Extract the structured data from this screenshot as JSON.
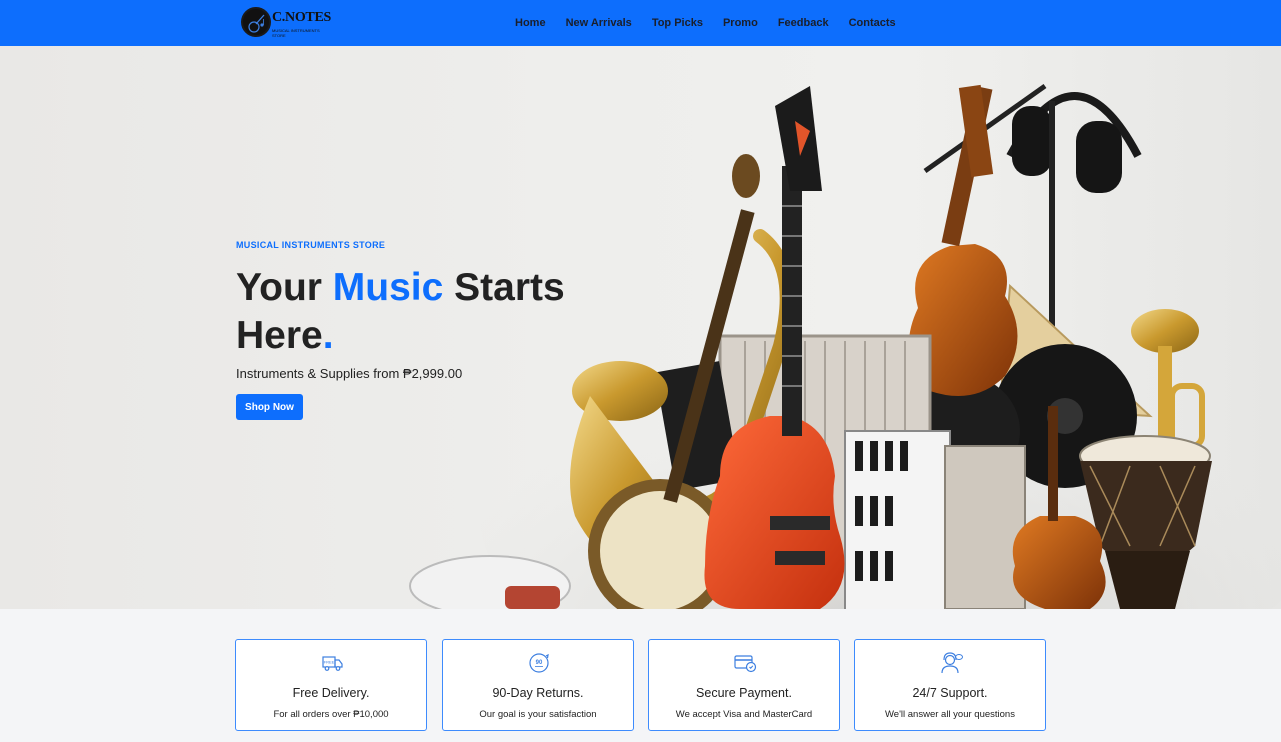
{
  "brand": {
    "name": "C.NOTES",
    "tagline": "MUSICAL INSTRUMENTS STORE"
  },
  "nav": {
    "items": [
      "Home",
      "New Arrivals",
      "Top Picks",
      "Promo",
      "Feedback",
      "Contacts"
    ]
  },
  "hero": {
    "eyebrow": "MUSICAL INSTRUMENTS STORE",
    "headline_part1": "Your ",
    "headline_accent": "Music",
    "headline_part2": " Starts Here",
    "headline_dot": ".",
    "subtitle": "Instruments & Supplies from ₱2,999.00",
    "cta_label": "Shop Now"
  },
  "features": [
    {
      "icon": "free-delivery-truck-icon",
      "title": "Free Delivery.",
      "description": "For all orders over ₱10,000"
    },
    {
      "icon": "90-day-returns-icon",
      "title": "90-Day Returns.",
      "description": "Our goal is your satisfaction"
    },
    {
      "icon": "secure-payment-card-icon",
      "title": "Secure Payment.",
      "description": "We accept Visa and MasterCard"
    },
    {
      "icon": "support-agent-icon",
      "title": "24/7 Support.",
      "description": "We'll answer all your questions"
    }
  ],
  "icon_text": {
    "free": "FREE",
    "ninety": "90"
  },
  "colors": {
    "primary": "#0d6efd",
    "text": "#222222",
    "hero_bg": "#ececea"
  }
}
